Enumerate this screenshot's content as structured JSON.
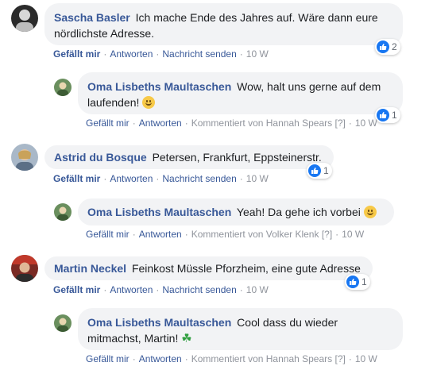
{
  "colors": {
    "link": "#385898",
    "muted": "#90949c",
    "bubble": "#f2f3f5",
    "like": "#1877f2"
  },
  "labels": {
    "like": "Gefällt mir",
    "reply": "Antworten",
    "message": "Nachricht senden",
    "sep": "·",
    "q": "[?]"
  },
  "comments": [
    {
      "author": "Sascha Basler",
      "text": "Ich mache Ende des Jahres auf. Wäre dann eure nördlichste Adresse.",
      "likes": "2",
      "time": "10 W",
      "avatar_icon": "person-photo-icon",
      "reply": {
        "author": "Oma Lisbeths Maultaschen",
        "text": "Wow, halt uns gerne auf dem laufenden!",
        "emoji": "smile-emoji-icon",
        "likes": "1",
        "commented_by": "Kommentiert von Hannah Spears",
        "time": "10 W"
      }
    },
    {
      "author": "Astrid du Bosque",
      "text": "Petersen, Frankfurt, Eppsteinerstr.",
      "likes": "1",
      "time": "10 W",
      "avatar_icon": "person-photo-icon",
      "reply": {
        "author": "Oma Lisbeths Maultaschen",
        "text": "Yeah! Da gehe ich vorbei",
        "emoji": "smile-emoji-icon",
        "likes": "",
        "commented_by": "Kommentiert von Volker Klenk",
        "time": "10 W"
      }
    },
    {
      "author": "Martin Neckel",
      "text": "Feinkost Müssle Pforzheim, eine gute Adresse",
      "likes": "1",
      "time": "10 W",
      "avatar_icon": "person-photo-icon",
      "reply": {
        "author": "Oma Lisbeths Maultaschen",
        "text": "Cool dass du wieder mitmachst, Martin!",
        "emoji": "four-leaf-clover-icon",
        "likes": "",
        "commented_by": "Kommentiert von Hannah Spears",
        "time": "10 W"
      }
    }
  ]
}
